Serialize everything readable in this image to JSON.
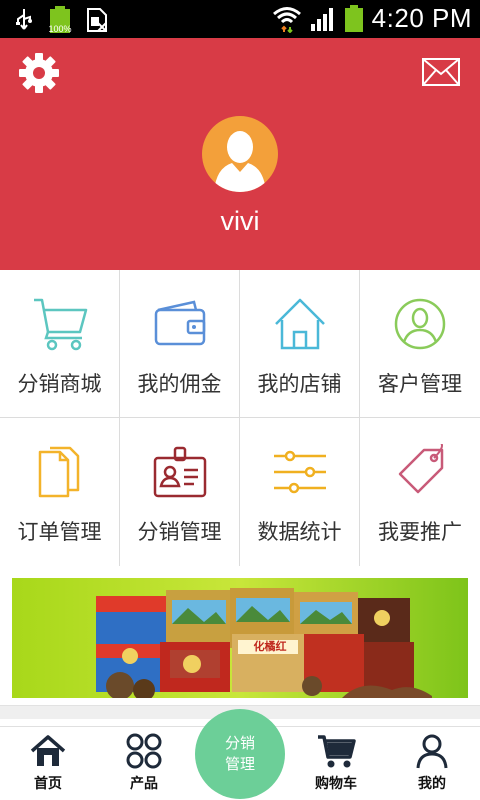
{
  "status_bar": {
    "time": "4:20 PM",
    "battery_percent": "100%"
  },
  "header": {
    "username": "vivi",
    "background_color": "#d83b46",
    "avatar_color": "#f3a03a"
  },
  "menu": {
    "items": [
      {
        "label": "分销商城",
        "icon": "shopping-cart-icon",
        "color": "#5cc6c0"
      },
      {
        "label": "我的佣金",
        "icon": "wallet-icon",
        "color": "#5a8fd8"
      },
      {
        "label": "我的店铺",
        "icon": "house-icon",
        "color": "#4ab8d8"
      },
      {
        "label": "客户管理",
        "icon": "user-circle-icon",
        "color": "#8acb5a"
      },
      {
        "label": "订单管理",
        "icon": "documents-icon",
        "color": "#f3b32a"
      },
      {
        "label": "分销管理",
        "icon": "id-badge-icon",
        "color": "#9a2a30"
      },
      {
        "label": "数据统计",
        "icon": "sliders-icon",
        "color": "#f0b020"
      },
      {
        "label": "我要推广",
        "icon": "price-tag-icon",
        "color": "#c85a78"
      }
    ]
  },
  "banner": {
    "product_text": "化橘红"
  },
  "bottom_nav": {
    "items": [
      {
        "label": "首页",
        "icon": "home-icon"
      },
      {
        "label": "产品",
        "icon": "grid-four-circles-icon"
      },
      {
        "label": "分销管理",
        "icon": "center-circle"
      },
      {
        "label": "购物车",
        "icon": "cart-icon"
      },
      {
        "label": "我的",
        "icon": "person-icon"
      }
    ],
    "center_color": "#6ccf98"
  }
}
